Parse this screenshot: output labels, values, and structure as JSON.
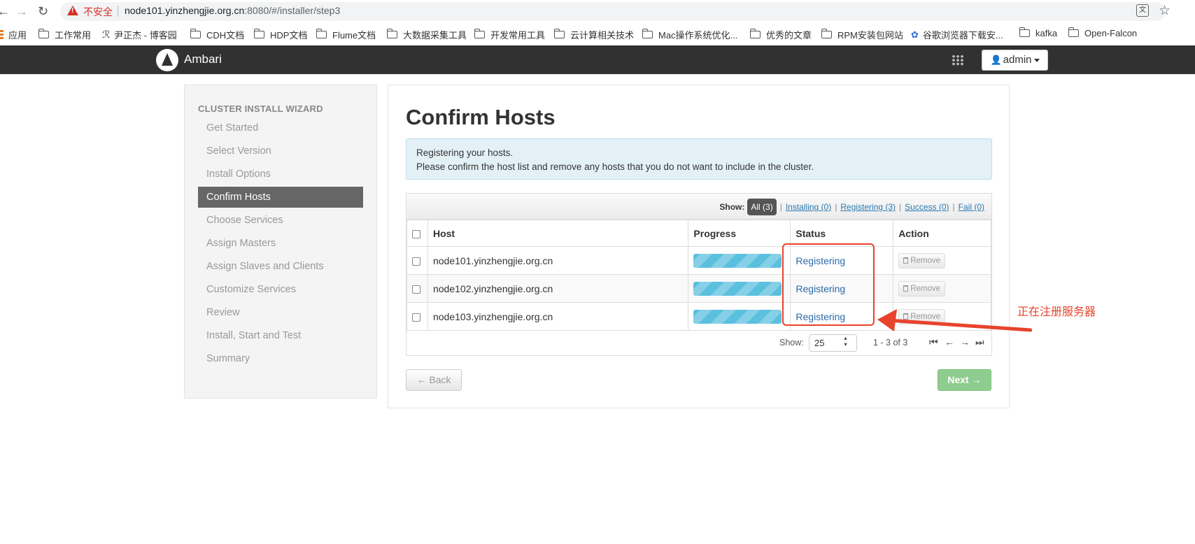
{
  "browser": {
    "insecure_label": "不安全",
    "url_host": "node101.yinzhengjie.org.cn",
    "url_rest": ":8080/#/installer/step3",
    "bookmarks": [
      "应用",
      "工作常用",
      "尹正杰 - 博客园",
      "CDH文档",
      "HDP文档",
      "Flume文档",
      "大数据采集工具",
      "开发常用工具",
      "云计算相关技术",
      "Mac操作系统优化...",
      "优秀的文章",
      "RPM安装包网站",
      "谷歌浏览器下载安...",
      "kafka",
      "Open-Falcon"
    ]
  },
  "app": {
    "brand": "Ambari",
    "user_button": "admin"
  },
  "sidebar": {
    "title": "CLUSTER INSTALL WIZARD",
    "items": [
      "Get Started",
      "Select Version",
      "Install Options",
      "Confirm Hosts",
      "Choose Services",
      "Assign Masters",
      "Assign Slaves and Clients",
      "Customize Services",
      "Review",
      "Install, Start and Test",
      "Summary"
    ],
    "active_index": 3
  },
  "main": {
    "title": "Confirm Hosts",
    "alert_line1": "Registering your hosts.",
    "alert_line2": "Please confirm the host list and remove any hosts that you do not want to include in the cluster.",
    "filters": {
      "label": "Show:",
      "all": "All (3)",
      "installing": "Installing (0)",
      "registering": "Registering (3)",
      "success": "Success (0)",
      "fail": "Fail (0)"
    },
    "columns": [
      "Host",
      "Progress",
      "Status",
      "Action"
    ],
    "hosts": [
      {
        "host": "node101.yinzhengjie.org.cn",
        "status": "Registering",
        "action": "Remove"
      },
      {
        "host": "node102.yinzhengjie.org.cn",
        "status": "Registering",
        "action": "Remove"
      },
      {
        "host": "node103.yinzhengjie.org.cn",
        "status": "Registering",
        "action": "Remove"
      }
    ],
    "pager": {
      "show_label": "Show:",
      "page_size": "25",
      "range": "1 - 3 of 3"
    },
    "back_button": "← Back",
    "next_button": "Next →"
  },
  "annotation": {
    "text": "正在注册服务器",
    "color": "#e8432d"
  }
}
